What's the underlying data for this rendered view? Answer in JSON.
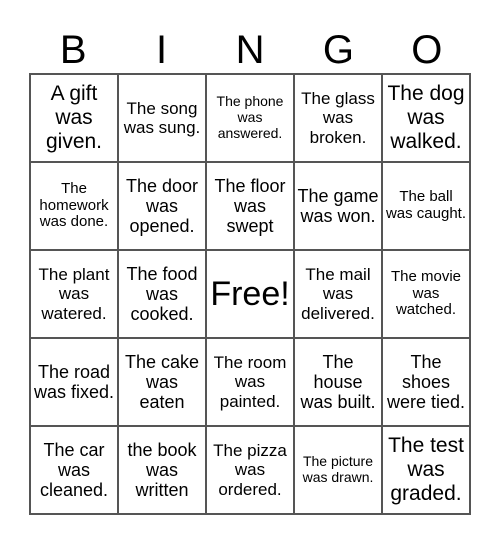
{
  "header": {
    "letters": [
      "B",
      "I",
      "N",
      "G",
      "O"
    ]
  },
  "cells": [
    [
      "A gift was given.",
      "The song was sung.",
      "The phone was answered.",
      "The glass was broken.",
      "The dog was walked."
    ],
    [
      "The homework was done.",
      "The door was opened.",
      "The floor was swept",
      "The game was won.",
      "The ball was caught."
    ],
    [
      "The plant was watered.",
      "The food was cooked.",
      "Free!",
      "The mail was delivered.",
      "The movie was watched."
    ],
    [
      "The road was fixed.",
      "The cake was eaten",
      "The room was painted.",
      "The house was built.",
      "The shoes were tied."
    ],
    [
      "The car was cleaned.",
      "the book was written",
      "The pizza was ordered.",
      "The picture was drawn.",
      "The test was graded."
    ]
  ]
}
